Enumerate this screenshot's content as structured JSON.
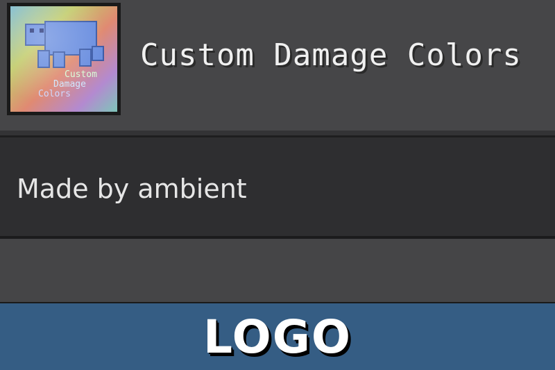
{
  "pack": {
    "title": "Custom Damage Colors",
    "author_line": "Made by ambient",
    "icon": {
      "name": "pack-icon",
      "text": [
        "Custom",
        "Damage",
        "Colors"
      ]
    }
  },
  "banner": {
    "label": "LOGO",
    "background": "#355d84"
  }
}
